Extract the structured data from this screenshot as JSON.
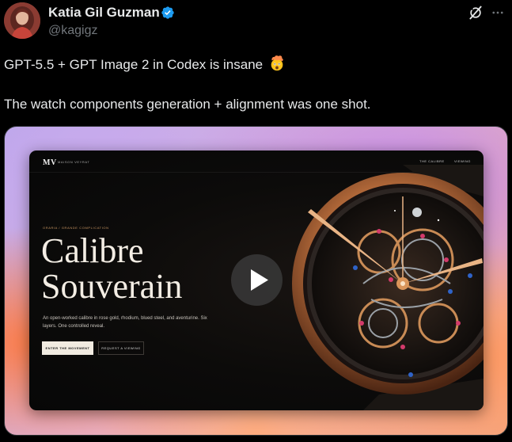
{
  "author": {
    "display_name": "Katia Gil Guzman",
    "handle": "@kagigz",
    "avatar_icon": "user-avatar"
  },
  "post": {
    "line1": "GPT-5.5 + GPT Image 2 in Codex is insane",
    "line1_emoji": "exploding-head-emoji",
    "line2": "The watch components generation + alignment was one shot."
  },
  "actions": {
    "grok_icon": "grok-icon",
    "more_icon": "more-horizontal-icon"
  },
  "media": {
    "type": "video",
    "play_icon": "play-icon",
    "site": {
      "logo": "MV",
      "brand": "MAISON VEYRAT",
      "nav": [
        "THE CALIBRE",
        "VIEWING"
      ],
      "eyebrow": "ORARIA / GRANDE COMPLICATION",
      "title_line1": "Calibre",
      "title_line2": "Souverain",
      "description": "An open-worked calibre in rose gold, rhodium, blued steel, and aventurine. Six layers. One controlled reveal.",
      "primary_button": "ENTER THE MOVEMENT",
      "secondary_button": "REQUEST A VIEWING"
    }
  },
  "colors": {
    "background": "#000000",
    "text": "#e7e9ea",
    "muted": "#71767b",
    "verified": "#1d9bf0",
    "rose_gold": "#c89562"
  }
}
